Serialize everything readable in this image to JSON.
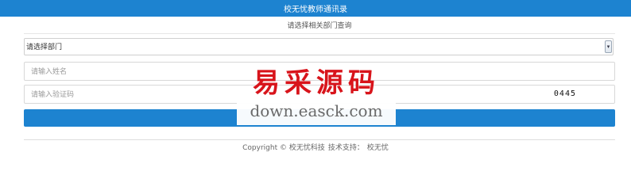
{
  "header": {
    "title": "校无忧教师通讯录"
  },
  "subtitle": "请选择相关部门查询",
  "department_select": {
    "selected": "请选择部门",
    "arrow_icon": "chevron-down-icon"
  },
  "name_input": {
    "placeholder": "请输入姓名",
    "value": ""
  },
  "code_input": {
    "placeholder": "请输入验证码",
    "value": ""
  },
  "captcha": {
    "code": "0445"
  },
  "submit_button": {
    "label": ""
  },
  "footer": {
    "copyright": "Copyright © 校无忧科技",
    "support_label": "技术支持：",
    "support_link": "校无忧"
  },
  "watermark": {
    "cn": "易采源码",
    "en": "down.easck.com",
    "cn_color": "#d8141b"
  },
  "colors": {
    "accent": "#1d83d0"
  }
}
